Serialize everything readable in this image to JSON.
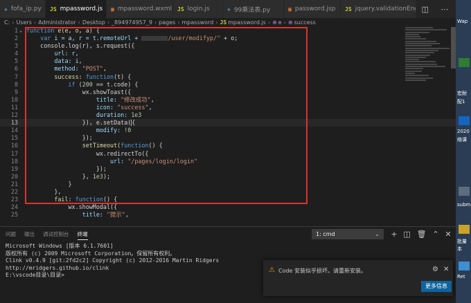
{
  "tabs": [
    {
      "icon": "py",
      "label": "fofa_ip.py",
      "active": false
    },
    {
      "icon": "JS",
      "label": "mpassword.js",
      "active": true
    },
    {
      "icon": "xml",
      "label": "mpassword.wxml",
      "active": false
    },
    {
      "icon": "JS",
      "label": "login.js",
      "active": false
    },
    {
      "icon": "py",
      "label": "99乘法表.py",
      "active": false
    },
    {
      "icon": "jsp",
      "label": "password.jsp",
      "active": false
    },
    {
      "icon": "JS",
      "label": "jquery.validationEngine-cn.js",
      "active": false
    }
  ],
  "breadcrumb": {
    "path": [
      "C:",
      "Users",
      "Administrator",
      "Desktop",
      "_894974957_9",
      "pages",
      "mpassword",
      "mpassword.js",
      "e",
      "success"
    ]
  },
  "editor": {
    "current_line": 13,
    "lines": [
      {
        "n": "1"
      },
      {
        "n": "2"
      },
      {
        "n": "3"
      },
      {
        "n": "4"
      },
      {
        "n": "5"
      },
      {
        "n": "6"
      },
      {
        "n": "7"
      },
      {
        "n": "8"
      },
      {
        "n": "9"
      },
      {
        "n": "10"
      },
      {
        "n": "11"
      },
      {
        "n": "12"
      },
      {
        "n": "13"
      },
      {
        "n": "14"
      },
      {
        "n": "15"
      },
      {
        "n": "16"
      },
      {
        "n": "17"
      },
      {
        "n": "18"
      },
      {
        "n": "19"
      },
      {
        "n": "20"
      },
      {
        "n": "21"
      },
      {
        "n": "22"
      },
      {
        "n": "23"
      },
      {
        "n": "24"
      },
      {
        "n": "25"
      }
    ],
    "text": {
      "l1_fn": "function",
      "l1_sig": "e(e, o, a) {",
      "l2_var": "var",
      "l2_a": "i = a, r = t.remoteUrl + ",
      "l2_str": "/user/modifyp/\"",
      "l2_b": " + o;",
      "l3": "console.log(r), s.request({",
      "l4": "url: r,",
      "l5": "data: i,",
      "l6_k": "method: ",
      "l6_v": "\"POST\"",
      "l6_c": ",",
      "l7_k": "success: ",
      "l7_f": "function",
      "l7_r": "(t) {",
      "l8_if": "if",
      "l8_p1": " (",
      "l8_n": "200",
      "l8_p2": " == t.code) {",
      "l9": "wx.showToast({",
      "l10_k": "title: ",
      "l10_v": "\"修改成功\"",
      "l10_c": ",",
      "l11_k": "icon: ",
      "l11_v": "\"success\"",
      "l11_c": ",",
      "l12_k": "duration: ",
      "l12_v": "1e3",
      "l13": "}), e.setData(",
      "l14_k": "modify: ",
      "l14_v": "!0",
      "l15": "});",
      "l16_a": "setTimeout(",
      "l16_f": "function",
      "l16_b": "() {",
      "l17": "wx.redirectTo({",
      "l18_k": "url: ",
      "l18_v": "\"/pages/login/login\"",
      "l19": "});",
      "l20_a": "}, ",
      "l20_n": "1e3",
      "l20_b": ");",
      "l21": "}",
      "l22": "},",
      "l23_k": "fail: ",
      "l23_f": "function",
      "l23_b": "() {",
      "l24": "wx.showModal({",
      "l25_k": "title: ",
      "l25_v": "\"提示\"",
      "l25_c": ","
    }
  },
  "panel": {
    "tabs": [
      "问题",
      "输出",
      "调试控制台",
      "终端"
    ],
    "active_tab": "终端",
    "terminal_select": "1: cmd",
    "terminal_lines": [
      "Microsoft Windows [版本 6.1.7601]",
      "版权所有 (c) 2009 Microsoft Corporation。保留所有权利。",
      "Clink v0.4.9 [git:2fd2c2] Copyright (c) 2012-2016 Martin Ridgers",
      "http://mridgers.github.io/clink",
      "",
      "",
      "E:\\vscode目录\\目录>"
    ]
  },
  "notification": {
    "message": "Code 安装似乎损坏。请重新安装。",
    "button": "更多信息"
  },
  "desktop": {
    "labels": [
      "Wap",
      "宏耐",
      "配1",
      "2020",
      "络课",
      "subm",
      "批量",
      "本",
      "Ret"
    ]
  },
  "colors": {
    "highlight_box": "#e0312d",
    "editor_bg": "#1e1e1e",
    "keyword": "#569cd6",
    "string": "#ce9178",
    "number": "#b5cea8",
    "button": "#0e639c"
  }
}
